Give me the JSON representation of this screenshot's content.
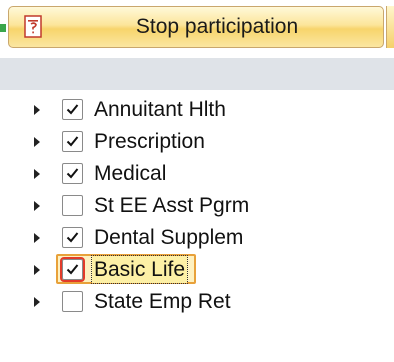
{
  "toolbar": {
    "stop_button_label": "Stop participation",
    "stop_button_icon": "document-icon"
  },
  "tree": {
    "items": [
      {
        "label": "Annuitant Hlth",
        "checked": true,
        "selected": false
      },
      {
        "label": "Prescription",
        "checked": true,
        "selected": false
      },
      {
        "label": "Medical",
        "checked": true,
        "selected": false
      },
      {
        "label": "St EE Asst Pgrm",
        "checked": false,
        "selected": false
      },
      {
        "label": "Dental Supplem",
        "checked": true,
        "selected": false
      },
      {
        "label": "Basic Life",
        "checked": true,
        "selected": true
      },
      {
        "label": "State Emp Ret",
        "checked": false,
        "selected": false
      }
    ]
  },
  "colors": {
    "button_gradient_top": "#fff9d9",
    "button_gradient_bottom": "#f7d46c",
    "subheader_bg": "#dfe3e8",
    "selection_border": "#e8a13a",
    "selection_checkbox_outline": "#e23b2a"
  }
}
